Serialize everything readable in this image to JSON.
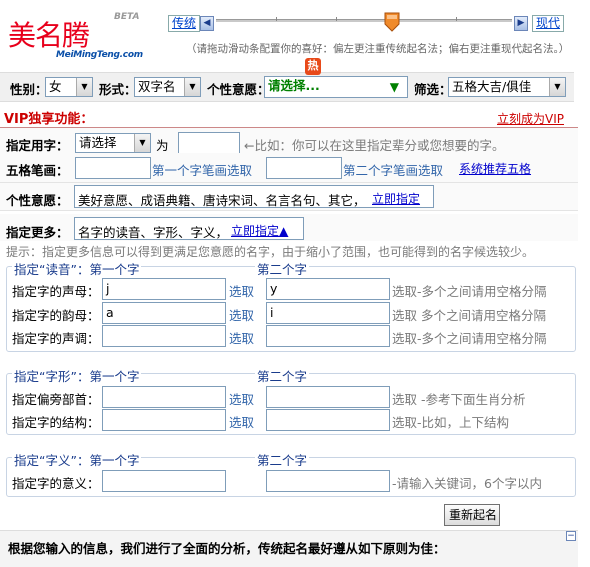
{
  "brand": {
    "logo_text": "美名腾",
    "beta": "BETA",
    "url": "MeiMingTeng.com",
    "accent": "#e8001c"
  },
  "slider": {
    "left_label": "传统",
    "right_label": "现代",
    "left_arrow": "◀",
    "right_arrow": "▶",
    "hint": "（请拖动滑动条配置你的喜好：偏左更注重传统起名法；偏右更注重现代起名法。）"
  },
  "filters": {
    "gender_label": "性别：",
    "gender_value": "女",
    "form_label": "形式：",
    "form_value": "双字名",
    "wish_label": "个性意愿：",
    "wish_value": "请选择...",
    "hot_badge": "热",
    "filter_label": "筛选：",
    "filter_value": "五格大吉/俱佳"
  },
  "vip": {
    "title": "VIP独享功能：",
    "become_link": "立刻成为VIP"
  },
  "specify_char": {
    "label": "指定用字：",
    "select_value": "请选择",
    "as_text": "为",
    "hint": "←比如：你可以在这里指定辈分或您想要的字。"
  },
  "strokes": {
    "label": "五格笔画：",
    "first_link": "第一个字笔画选取",
    "second_link": "第二个字笔画选取",
    "recommend_link": "系统推荐五格"
  },
  "wish": {
    "label": "个性意愿：",
    "text": "美好意愿、成语典籍、唐诗宋词、名言名句、其它，",
    "link": "立即指定"
  },
  "more": {
    "label": "指定更多：",
    "text": "名字的读音、字形、字义，",
    "link": "立即指定▲"
  },
  "tip": "提示：指定更多信息可以得到更满足您意愿的名字，由于缩小了范围，也可能得到的名字候选较少。",
  "reading": {
    "legend": "指定“读音”：第一个字",
    "second_legend": "第二个字",
    "pick": "选取",
    "rows": [
      {
        "label": "指定字的声母：",
        "v1": "j",
        "v2": "y",
        "hint": "选取-多个之间请用空格分隔"
      },
      {
        "label": "指定字的韵母：",
        "v1": "a",
        "v2": "i",
        "hint": "选取  多个之间请用空格分隔"
      },
      {
        "label": "指定字的声调：",
        "v1": "",
        "v2": "",
        "hint": "选取-多个之间请用空格分隔"
      }
    ]
  },
  "shape": {
    "legend": "指定“字形”：第一个字",
    "second_legend": "第二个字",
    "pick": "选取",
    "rows": [
      {
        "label": "指定偏旁部首：",
        "hint": "选取 -参考下面生肖分析"
      },
      {
        "label": "指定字的结构：",
        "hint": "选取-比如，上下结构"
      }
    ]
  },
  "meaning": {
    "legend": "指定“字义”：第一个字",
    "second_legend": "第二个字",
    "rows": [
      {
        "label": "指定字的意义：",
        "hint": "-请输入关键词，6个字以内"
      }
    ]
  },
  "reset_button": "重新起名",
  "bottom_text": "根据您输入的信息，我们进行了全面的分析，传统起名最好遵从如下原则为佳："
}
